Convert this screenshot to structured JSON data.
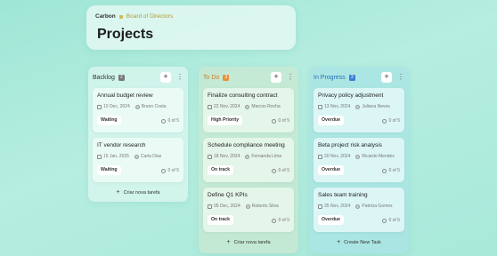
{
  "header": {
    "app": "Carbon",
    "board": "Board of Directors",
    "title": "Projects"
  },
  "columns": [
    {
      "name": "Backlog",
      "count": "2",
      "add_label": "Criar nova tarefa",
      "cards": [
        {
          "title": "Annual budget review",
          "date": "10 Dec, 2024",
          "assignee": "Bruno Costa",
          "status": "Waiting",
          "progress": "0 of 5"
        },
        {
          "title": "IT vendor research",
          "date": "15 Jan, 2025",
          "assignee": "Carla Dias",
          "status": "Waiting",
          "progress": "0 of 5"
        }
      ]
    },
    {
      "name": "To Do",
      "count": "3",
      "add_label": "Criar nova tarefa",
      "cards": [
        {
          "title": "Finalize consulting contract",
          "date": "22 Nov, 2024",
          "assignee": "Marcos Rocha",
          "status": "High Priority",
          "progress": "0 of 5"
        },
        {
          "title": "Schedule compliance meeting",
          "date": "18 Nov, 2024",
          "assignee": "Fernanda Lima",
          "status": "On track",
          "progress": "0 of 5"
        },
        {
          "title": "Define Q1 KPIs",
          "date": "05 Dec, 2024",
          "assignee": "Roberto Silva",
          "status": "On track",
          "progress": "0 of 5"
        }
      ]
    },
    {
      "name": "In Progress",
      "count": "3",
      "add_label": "Create New Task",
      "cards": [
        {
          "title": "Privacy policy adjustment",
          "date": "13 Nov, 2024",
          "assignee": "Juliana Neves",
          "status": "Overdue",
          "progress": "0 of 5"
        },
        {
          "title": "Beta project risk analysis",
          "date": "20 Nov, 2024",
          "assignee": "Ricardo Mendes",
          "status": "Overdue",
          "progress": "0 of 5"
        },
        {
          "title": "Sales team training",
          "date": "25 Nov, 2024",
          "assignee": "Patricia Gomes",
          "status": "Overdue",
          "progress": "0 of 5"
        }
      ]
    }
  ]
}
